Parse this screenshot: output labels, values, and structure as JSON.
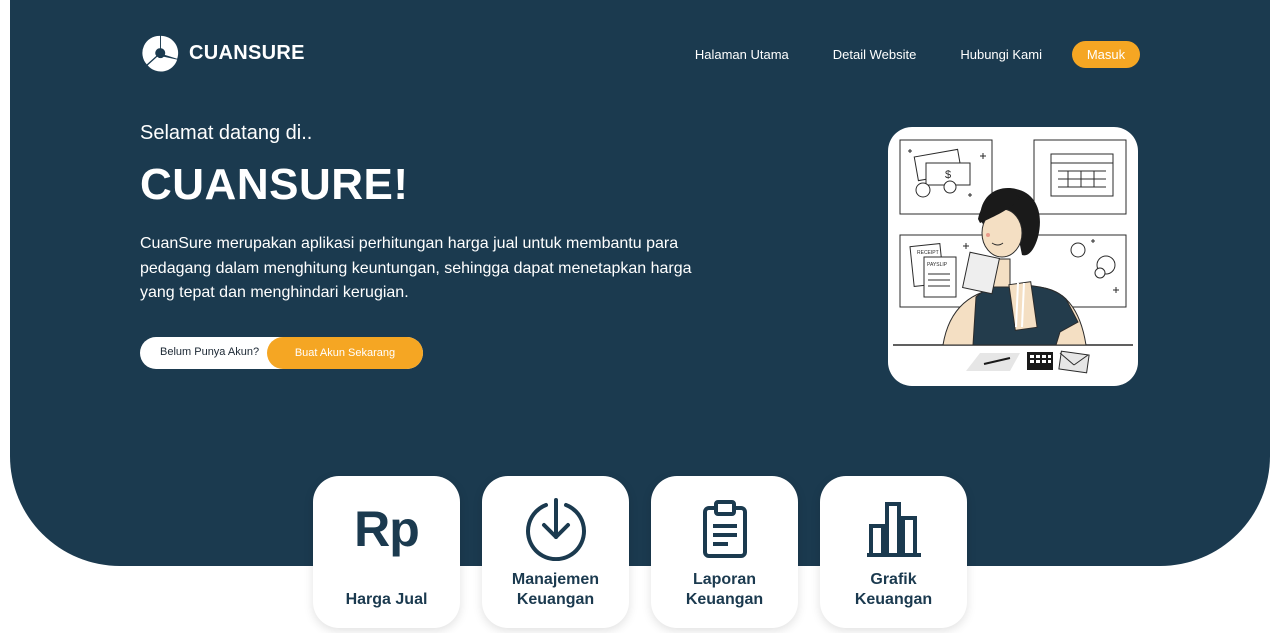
{
  "brand": {
    "name": "CUANSURE"
  },
  "nav": {
    "items": [
      "Halaman Utama",
      "Detail Website",
      "Hubungi Kami"
    ],
    "login_label": "Masuk"
  },
  "hero": {
    "welcome": "Selamat datang di..",
    "title": "CUANSURE!",
    "description": "CuanSure merupakan aplikasi perhitungan harga jual untuk membantu para pedagang dalam menghitung keuntungan, sehingga dapat menetapkan harga yang tepat dan menghindari kerugian.",
    "cta_prompt": "Belum Punya Akun?",
    "cta_button": "Buat Akun Sekarang",
    "illustration_text": {
      "receipt": "RECEIPT",
      "payslip": "PAYSLIP",
      "dollar": "$"
    }
  },
  "features": [
    {
      "icon": "rupiah-icon",
      "icon_text": "Rp",
      "line1": "Harga Jual",
      "line2": ""
    },
    {
      "icon": "download-icon",
      "line1": "Manajemen",
      "line2": "Keuangan"
    },
    {
      "icon": "clipboard-icon",
      "line1": "Laporan",
      "line2": "Keuangan"
    },
    {
      "icon": "bar-chart-icon",
      "line1": "Grafik",
      "line2": "Keuangan"
    }
  ],
  "colors": {
    "primary": "#1b3a4f",
    "accent": "#f5a623",
    "background": "#ffffff"
  }
}
